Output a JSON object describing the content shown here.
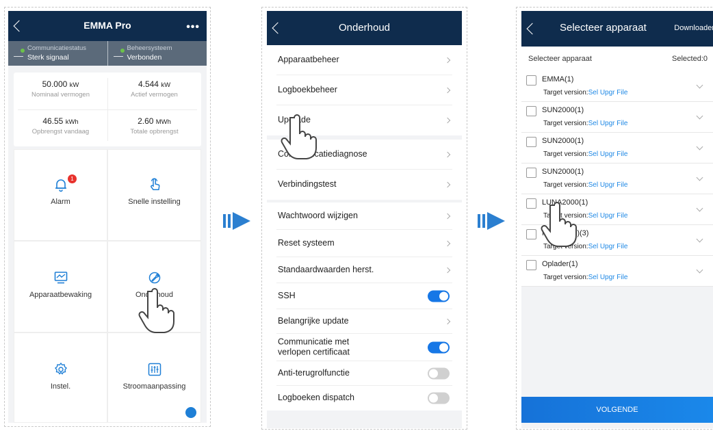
{
  "colors": {
    "navbar": "#0f2c4d",
    "status_strip": "#5b6a7a",
    "accent": "#1677e6",
    "badge": "#e8322d",
    "arrow": "#2b7fd0"
  },
  "screen1": {
    "title": "EMMA Pro",
    "more_icon": "more-dots-icon",
    "status": [
      {
        "label": "Communicatiestatus",
        "value": "Sterk signaal"
      },
      {
        "label": "Beheersysteem",
        "value": "Verbonden"
      }
    ],
    "stats": [
      {
        "value": "50.000",
        "unit": "kW",
        "label": "Nominaal vermogen"
      },
      {
        "value": "4.544",
        "unit": "kW",
        "label": "Actief vermogen"
      },
      {
        "value": "46.55",
        "unit": "kWh",
        "label": "Opbrengst vandaag"
      },
      {
        "value": "2.60",
        "unit": "MWh",
        "label": "Totale opbrengst"
      }
    ],
    "tiles": [
      {
        "label": "Alarm",
        "icon": "bell-icon",
        "badge": "1"
      },
      {
        "label": "Snelle instelling",
        "icon": "tap-icon"
      },
      {
        "label": "Apparaatbewaking",
        "icon": "monitor-icon"
      },
      {
        "label": "Onderhoud",
        "icon": "wrench-icon"
      },
      {
        "label": "Instel.",
        "icon": "gear-icon"
      },
      {
        "label": "Stroomaanpassing",
        "icon": "sliders-icon"
      }
    ]
  },
  "screen2": {
    "title": "Onderhoud",
    "groups": [
      [
        {
          "label": "Apparaatbeheer",
          "control": "chevron"
        },
        {
          "label": "Logboekbeheer",
          "control": "chevron"
        },
        {
          "label": "Upgrade",
          "control": "chevron"
        }
      ],
      [
        {
          "label": "Communicatiediagnose",
          "control": "chevron"
        },
        {
          "label": "Verbindingstest",
          "control": "chevron"
        }
      ],
      [
        {
          "label": "Wachtwoord wijzigen",
          "control": "chevron"
        },
        {
          "label": "Reset systeem",
          "control": "chevron"
        },
        {
          "label": "Standaardwaarden herst.",
          "control": "chevron"
        },
        {
          "label": "SSH",
          "control": "toggle",
          "on": true
        },
        {
          "label": "Belangrijke update",
          "control": "chevron"
        },
        {
          "label": "Communicatie met verlopen certificaat",
          "control": "toggle",
          "on": true
        },
        {
          "label": "Anti-terugrolfunctie",
          "control": "toggle",
          "on": false
        },
        {
          "label": "Logboeken dispatch",
          "control": "toggle",
          "on": false
        }
      ]
    ]
  },
  "screen3": {
    "title": "Selecteer apparaat",
    "action": "Downloader",
    "header_left": "Selecteer apparaat",
    "header_right": "Selected:0",
    "target_prefix": "Target version:",
    "target_link": "Sel Upgr File",
    "devices": [
      {
        "name": "EMMA(1)"
      },
      {
        "name": "SUN2000(1)"
      },
      {
        "name": "SUN2000(1)"
      },
      {
        "name": "SUN2000(1)"
      },
      {
        "name": "LUNA2000(1)"
      },
      {
        "name": "MBUS(DC)(3)"
      },
      {
        "name": "Oplader(1)"
      }
    ],
    "next_button": "VOLGENDE"
  }
}
